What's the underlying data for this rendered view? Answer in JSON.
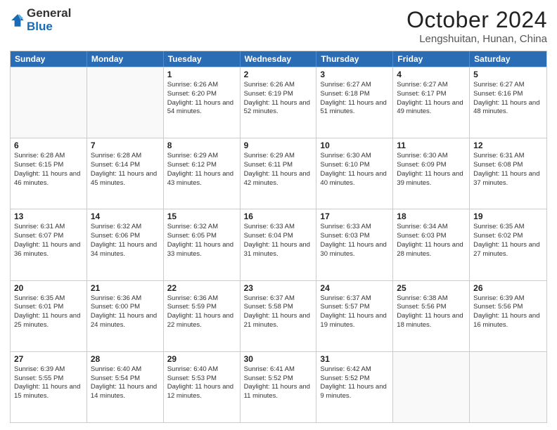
{
  "logo": {
    "general": "General",
    "blue": "Blue"
  },
  "header": {
    "month": "October 2024",
    "location": "Lengshuitan, Hunan, China"
  },
  "weekdays": [
    "Sunday",
    "Monday",
    "Tuesday",
    "Wednesday",
    "Thursday",
    "Friday",
    "Saturday"
  ],
  "rows": [
    [
      {
        "day": "",
        "sunrise": "",
        "sunset": "",
        "daylight": ""
      },
      {
        "day": "",
        "sunrise": "",
        "sunset": "",
        "daylight": ""
      },
      {
        "day": "1",
        "sunrise": "Sunrise: 6:26 AM",
        "sunset": "Sunset: 6:20 PM",
        "daylight": "Daylight: 11 hours and 54 minutes."
      },
      {
        "day": "2",
        "sunrise": "Sunrise: 6:26 AM",
        "sunset": "Sunset: 6:19 PM",
        "daylight": "Daylight: 11 hours and 52 minutes."
      },
      {
        "day": "3",
        "sunrise": "Sunrise: 6:27 AM",
        "sunset": "Sunset: 6:18 PM",
        "daylight": "Daylight: 11 hours and 51 minutes."
      },
      {
        "day": "4",
        "sunrise": "Sunrise: 6:27 AM",
        "sunset": "Sunset: 6:17 PM",
        "daylight": "Daylight: 11 hours and 49 minutes."
      },
      {
        "day": "5",
        "sunrise": "Sunrise: 6:27 AM",
        "sunset": "Sunset: 6:16 PM",
        "daylight": "Daylight: 11 hours and 48 minutes."
      }
    ],
    [
      {
        "day": "6",
        "sunrise": "Sunrise: 6:28 AM",
        "sunset": "Sunset: 6:15 PM",
        "daylight": "Daylight: 11 hours and 46 minutes."
      },
      {
        "day": "7",
        "sunrise": "Sunrise: 6:28 AM",
        "sunset": "Sunset: 6:14 PM",
        "daylight": "Daylight: 11 hours and 45 minutes."
      },
      {
        "day": "8",
        "sunrise": "Sunrise: 6:29 AM",
        "sunset": "Sunset: 6:12 PM",
        "daylight": "Daylight: 11 hours and 43 minutes."
      },
      {
        "day": "9",
        "sunrise": "Sunrise: 6:29 AM",
        "sunset": "Sunset: 6:11 PM",
        "daylight": "Daylight: 11 hours and 42 minutes."
      },
      {
        "day": "10",
        "sunrise": "Sunrise: 6:30 AM",
        "sunset": "Sunset: 6:10 PM",
        "daylight": "Daylight: 11 hours and 40 minutes."
      },
      {
        "day": "11",
        "sunrise": "Sunrise: 6:30 AM",
        "sunset": "Sunset: 6:09 PM",
        "daylight": "Daylight: 11 hours and 39 minutes."
      },
      {
        "day": "12",
        "sunrise": "Sunrise: 6:31 AM",
        "sunset": "Sunset: 6:08 PM",
        "daylight": "Daylight: 11 hours and 37 minutes."
      }
    ],
    [
      {
        "day": "13",
        "sunrise": "Sunrise: 6:31 AM",
        "sunset": "Sunset: 6:07 PM",
        "daylight": "Daylight: 11 hours and 36 minutes."
      },
      {
        "day": "14",
        "sunrise": "Sunrise: 6:32 AM",
        "sunset": "Sunset: 6:06 PM",
        "daylight": "Daylight: 11 hours and 34 minutes."
      },
      {
        "day": "15",
        "sunrise": "Sunrise: 6:32 AM",
        "sunset": "Sunset: 6:05 PM",
        "daylight": "Daylight: 11 hours and 33 minutes."
      },
      {
        "day": "16",
        "sunrise": "Sunrise: 6:33 AM",
        "sunset": "Sunset: 6:04 PM",
        "daylight": "Daylight: 11 hours and 31 minutes."
      },
      {
        "day": "17",
        "sunrise": "Sunrise: 6:33 AM",
        "sunset": "Sunset: 6:03 PM",
        "daylight": "Daylight: 11 hours and 30 minutes."
      },
      {
        "day": "18",
        "sunrise": "Sunrise: 6:34 AM",
        "sunset": "Sunset: 6:03 PM",
        "daylight": "Daylight: 11 hours and 28 minutes."
      },
      {
        "day": "19",
        "sunrise": "Sunrise: 6:35 AM",
        "sunset": "Sunset: 6:02 PM",
        "daylight": "Daylight: 11 hours and 27 minutes."
      }
    ],
    [
      {
        "day": "20",
        "sunrise": "Sunrise: 6:35 AM",
        "sunset": "Sunset: 6:01 PM",
        "daylight": "Daylight: 11 hours and 25 minutes."
      },
      {
        "day": "21",
        "sunrise": "Sunrise: 6:36 AM",
        "sunset": "Sunset: 6:00 PM",
        "daylight": "Daylight: 11 hours and 24 minutes."
      },
      {
        "day": "22",
        "sunrise": "Sunrise: 6:36 AM",
        "sunset": "Sunset: 5:59 PM",
        "daylight": "Daylight: 11 hours and 22 minutes."
      },
      {
        "day": "23",
        "sunrise": "Sunrise: 6:37 AM",
        "sunset": "Sunset: 5:58 PM",
        "daylight": "Daylight: 11 hours and 21 minutes."
      },
      {
        "day": "24",
        "sunrise": "Sunrise: 6:37 AM",
        "sunset": "Sunset: 5:57 PM",
        "daylight": "Daylight: 11 hours and 19 minutes."
      },
      {
        "day": "25",
        "sunrise": "Sunrise: 6:38 AM",
        "sunset": "Sunset: 5:56 PM",
        "daylight": "Daylight: 11 hours and 18 minutes."
      },
      {
        "day": "26",
        "sunrise": "Sunrise: 6:39 AM",
        "sunset": "Sunset: 5:56 PM",
        "daylight": "Daylight: 11 hours and 16 minutes."
      }
    ],
    [
      {
        "day": "27",
        "sunrise": "Sunrise: 6:39 AM",
        "sunset": "Sunset: 5:55 PM",
        "daylight": "Daylight: 11 hours and 15 minutes."
      },
      {
        "day": "28",
        "sunrise": "Sunrise: 6:40 AM",
        "sunset": "Sunset: 5:54 PM",
        "daylight": "Daylight: 11 hours and 14 minutes."
      },
      {
        "day": "29",
        "sunrise": "Sunrise: 6:40 AM",
        "sunset": "Sunset: 5:53 PM",
        "daylight": "Daylight: 11 hours and 12 minutes."
      },
      {
        "day": "30",
        "sunrise": "Sunrise: 6:41 AM",
        "sunset": "Sunset: 5:52 PM",
        "daylight": "Daylight: 11 hours and 11 minutes."
      },
      {
        "day": "31",
        "sunrise": "Sunrise: 6:42 AM",
        "sunset": "Sunset: 5:52 PM",
        "daylight": "Daylight: 11 hours and 9 minutes."
      },
      {
        "day": "",
        "sunrise": "",
        "sunset": "",
        "daylight": ""
      },
      {
        "day": "",
        "sunrise": "",
        "sunset": "",
        "daylight": ""
      }
    ]
  ]
}
